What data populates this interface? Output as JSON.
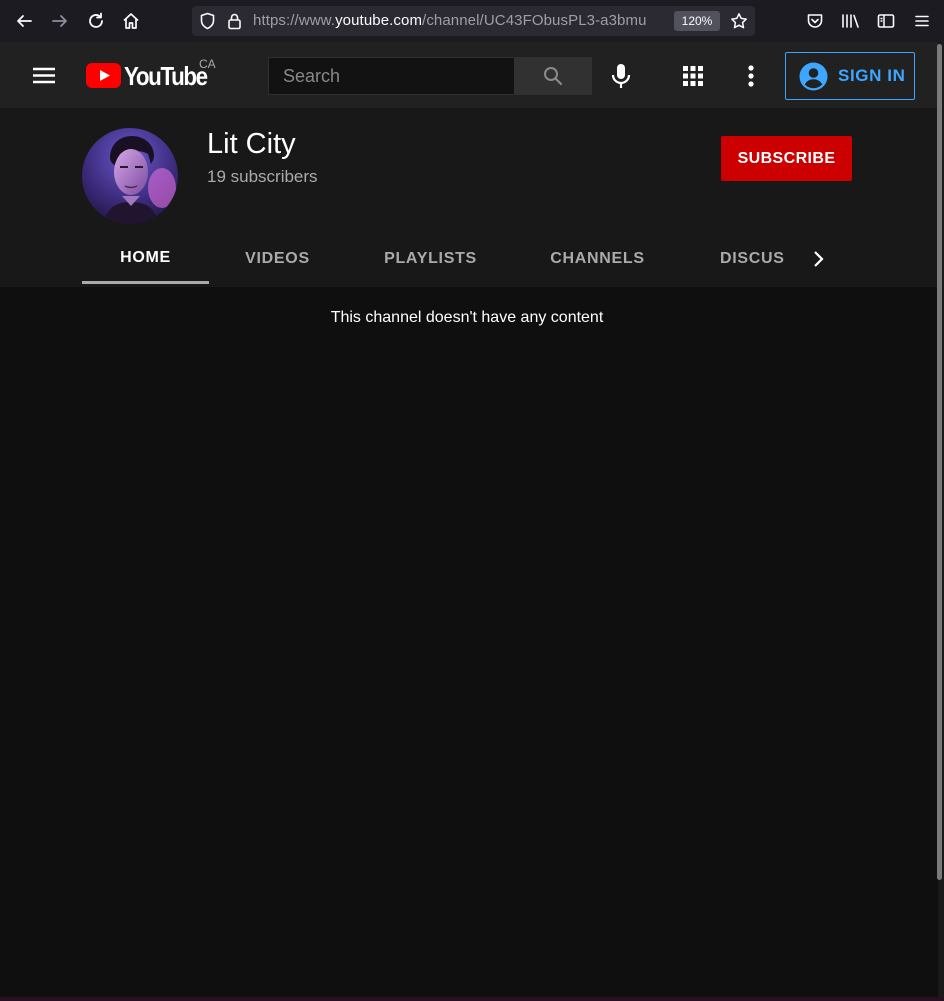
{
  "browser": {
    "url_prefix": "https://www.",
    "url_domain": "youtube.com",
    "url_rest": "/channel/UC43FObusPL3-a3bmu",
    "zoom": "120%"
  },
  "youtube": {
    "country_code": "CA",
    "logo_text": "YouTube",
    "search_placeholder": "Search",
    "sign_in_label": "SIGN IN"
  },
  "channel": {
    "name": "Lit City",
    "subscribers": "19 subscribers",
    "subscribe_label": "SUBSCRIBE"
  },
  "tabs": [
    {
      "label": "HOME",
      "active": true
    },
    {
      "label": "VIDEOS",
      "active": false
    },
    {
      "label": "PLAYLISTS",
      "active": false
    },
    {
      "label": "CHANNELS",
      "active": false
    },
    {
      "label": "DISCUSSION",
      "active": false
    }
  ],
  "content": {
    "empty_message": "This channel doesn't have any content"
  },
  "colors": {
    "accent_red": "#cc0000",
    "link_blue": "#3ea6ff",
    "background": "#0f0f0f"
  }
}
